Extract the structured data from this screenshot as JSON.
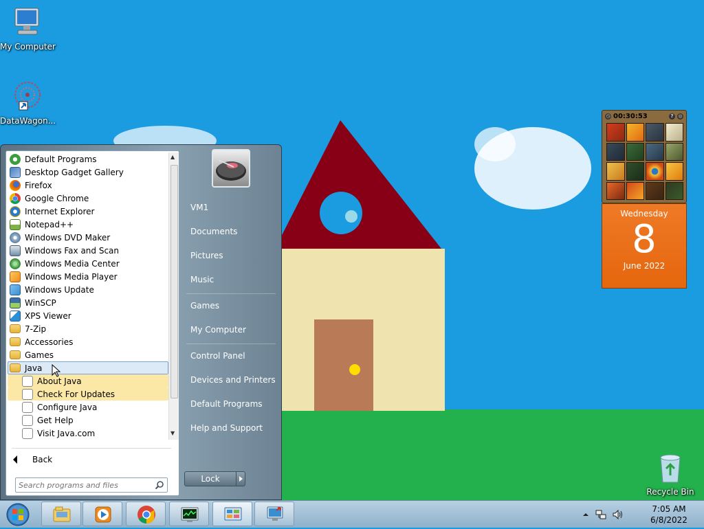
{
  "desktop": {
    "icons": [
      {
        "label": "My Computer",
        "icon": "computer-icon"
      },
      {
        "label": "DataWagon...",
        "icon": "network-shortcut-icon"
      },
      {
        "label": "Recycle Bin",
        "icon": "recycle-bin-icon"
      }
    ]
  },
  "gadgets": {
    "puzzle": {
      "timer": "00:30:53"
    },
    "calendar": {
      "weekday": "Wednesday",
      "day": "8",
      "month_year": "June 2022",
      "color": "#e86d16"
    }
  },
  "start_menu": {
    "programs": [
      {
        "label": "Default Programs",
        "icon": "default-programs-icon",
        "color": "#3b9d3b"
      },
      {
        "label": "Desktop Gadget Gallery",
        "icon": "gadget-gallery-icon",
        "color": "#4b7fc1"
      },
      {
        "label": "Firefox",
        "icon": "firefox-icon",
        "color": "#e66000"
      },
      {
        "label": "Google Chrome",
        "icon": "chrome-icon",
        "color": "#2a9d4a"
      },
      {
        "label": "Internet Explorer",
        "icon": "ie-icon",
        "color": "#2b78c8"
      },
      {
        "label": "Notepad++",
        "icon": "notepadpp-icon",
        "color": "#7cb342"
      },
      {
        "label": "Windows DVD Maker",
        "icon": "dvd-maker-icon",
        "color": "#5a7ea6"
      },
      {
        "label": "Windows Fax and Scan",
        "icon": "fax-scan-icon",
        "color": "#6f8fa8"
      },
      {
        "label": "Windows Media Center",
        "icon": "media-center-icon",
        "color": "#3c8d3c"
      },
      {
        "label": "Windows Media Player",
        "icon": "media-player-icon",
        "color": "#f08a1c"
      },
      {
        "label": "Windows Update",
        "icon": "windows-update-icon",
        "color": "#3a8ed0"
      },
      {
        "label": "WinSCP",
        "icon": "winscp-icon",
        "color": "#3b6fa8"
      },
      {
        "label": "XPS Viewer",
        "icon": "xps-viewer-icon",
        "color": "#2b8fd6"
      },
      {
        "label": "7-Zip",
        "icon": "folder-icon",
        "color": "#e9bb45"
      },
      {
        "label": "Accessories",
        "icon": "folder-icon",
        "color": "#e9bb45"
      },
      {
        "label": "Games",
        "icon": "folder-icon",
        "color": "#e9bb45"
      },
      {
        "label": "Java",
        "icon": "folder-icon",
        "color": "#e9bb45",
        "selected": true
      }
    ],
    "java_items": [
      {
        "label": "About Java",
        "highlighted": true
      },
      {
        "label": "Check For Updates",
        "highlighted": true
      },
      {
        "label": "Configure Java",
        "highlighted": false
      },
      {
        "label": "Get Help",
        "highlighted": false
      },
      {
        "label": "Visit Java.com",
        "highlighted": false
      }
    ],
    "back_label": "Back",
    "search_placeholder": "Search programs and files",
    "right_items": [
      "VM1",
      "Documents",
      "Pictures",
      "Music",
      "Games",
      "My Computer",
      "Control Panel",
      "Devices and Printers",
      "Default Programs",
      "Help and Support"
    ],
    "lock_label": "Lock"
  },
  "taskbar": {
    "buttons": [
      "windows-explorer-icon",
      "media-player-icon",
      "chrome-icon",
      "task-manager-icon",
      "control-panel-icon",
      "remote-desktop-icon"
    ],
    "active_button": "control-panel-icon",
    "time": "7:05 AM",
    "date": "6/8/2022"
  }
}
